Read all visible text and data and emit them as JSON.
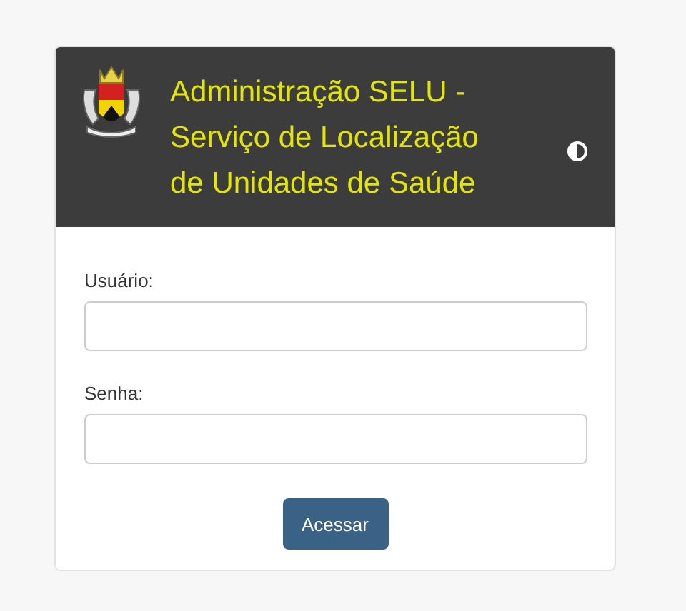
{
  "header": {
    "title": "Administração SELU - Serviço de Localização de Unidades de Saúde"
  },
  "form": {
    "fields": [
      {
        "label": "Usuário:"
      },
      {
        "label": "Senha:"
      }
    ],
    "submit": "Acessar"
  }
}
